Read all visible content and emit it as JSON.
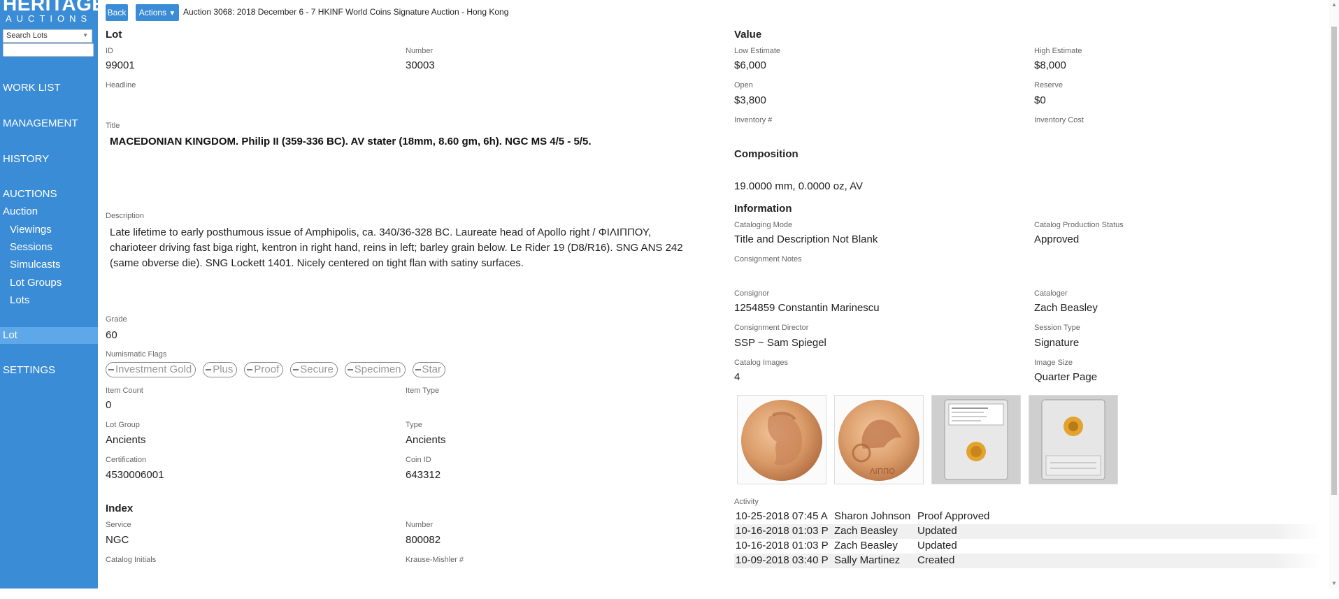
{
  "sidebar": {
    "logo_line1": "HERITAGE",
    "logo_line2": "AUCTIONS",
    "search_select": "Search Lots",
    "search_value": "",
    "items": [
      {
        "label": "WORK LIST"
      },
      {
        "label": "MANAGEMENT"
      },
      {
        "label": "HISTORY"
      },
      {
        "label": "AUCTIONS"
      },
      {
        "label": "Auction"
      },
      {
        "label": "Viewings"
      },
      {
        "label": "Sessions"
      },
      {
        "label": "Simulcasts"
      },
      {
        "label": "Lot Groups"
      },
      {
        "label": "Lots"
      },
      {
        "label": "Lot"
      },
      {
        "label": "SETTINGS"
      }
    ]
  },
  "toolbar": {
    "back_label": "Back",
    "actions_label": "Actions",
    "auction_title": "Auction 3068: 2018 December 6 - 7 HKINF World Coins Signature Auction - Hong Kong"
  },
  "lot": {
    "heading": "Lot",
    "id_label": "ID",
    "id_value": "99001",
    "number_label": "Number",
    "number_value": "30003",
    "headline_label": "Headline",
    "title_label": "Title",
    "title_value": "MACEDONIAN KINGDOM. Philip II (359-336 BC). AV stater (18mm, 8.60 gm, 6h). NGC MS 4/5 - 5/5.",
    "description_label": "Description",
    "description_value": "Late lifetime to early posthumous issue of Amphipolis, ca. 340/36-328 BC. Laureate head of Apollo right / ΦΙΛΙΠΠΟΥ, charioteer driving fast biga right, kentron in right hand, reins in left; barley grain below. Le Rider 19 (D8/R16). SNG ANS 242 (same obverse die). SNG Lockett 1401. Nicely centered on tight flan with satiny surfaces.",
    "grade_label": "Grade",
    "grade_value": "60",
    "flags_label": "Numismatic Flags",
    "flags": [
      "Investment Gold",
      "Plus",
      "Proof",
      "Secure",
      "Specimen",
      "Star"
    ],
    "item_count_label": "Item Count",
    "item_count_value": "0",
    "item_type_label": "Item Type",
    "lot_group_label": "Lot Group",
    "lot_group_value": "Ancients",
    "type_label": "Type",
    "type_value": "Ancients",
    "certification_label": "Certification",
    "certification_value": "4530006001",
    "coin_id_label": "Coin ID",
    "coin_id_value": "643312"
  },
  "index": {
    "heading": "Index",
    "service_label": "Service",
    "service_value": "NGC",
    "number_label": "Number",
    "number_value": "800082",
    "catalog_initials_label": "Catalog Initials",
    "krause_label": "Krause-Mishler #"
  },
  "value": {
    "heading": "Value",
    "low_label": "Low Estimate",
    "low_value": "$6,000",
    "high_label": "High Estimate",
    "high_value": "$8,000",
    "open_label": "Open",
    "open_value": "$3,800",
    "reserve_label": "Reserve",
    "reserve_value": "$0",
    "inventory_label": "Inventory #",
    "inventory_cost_label": "Inventory Cost"
  },
  "composition": {
    "heading": "Composition",
    "value": "19.0000 mm, 0.0000 oz, AV"
  },
  "information": {
    "heading": "Information",
    "cataloging_mode_label": "Cataloging Mode",
    "cataloging_mode_value": "Title and Description Not Blank",
    "production_status_label": "Catalog Production Status",
    "production_status_value": "Approved",
    "consignment_notes_label": "Consignment Notes",
    "consignor_label": "Consignor",
    "consignor_value": "1254859 Constantin Marinescu",
    "cataloger_label": "Cataloger",
    "cataloger_value": "Zach Beasley",
    "director_label": "Consignment Director",
    "director_value": "SSP ~ Sam Spiegel",
    "session_type_label": "Session Type",
    "session_type_value": "Signature",
    "catalog_images_label": "Catalog Images",
    "catalog_images_value": "4",
    "image_size_label": "Image Size",
    "image_size_value": "Quarter Page",
    "images": [
      "coin-obverse",
      "coin-reverse",
      "slab-front",
      "slab-back"
    ]
  },
  "activity": {
    "label": "Activity",
    "rows": [
      {
        "time": "10-25-2018 07:45 A",
        "user": "Sharon Johnson",
        "action": "Proof Approved"
      },
      {
        "time": "10-16-2018 01:03 P",
        "user": "Zach Beasley",
        "action": "Updated"
      },
      {
        "time": "10-16-2018 01:03 P",
        "user": "Zach Beasley",
        "action": "Updated"
      },
      {
        "time": "10-09-2018 03:40 P",
        "user": "Sally Martinez",
        "action": "Created"
      }
    ]
  },
  "colors": {
    "sidebar": "#3b8cd6",
    "active_item": "#5ea7e8"
  }
}
